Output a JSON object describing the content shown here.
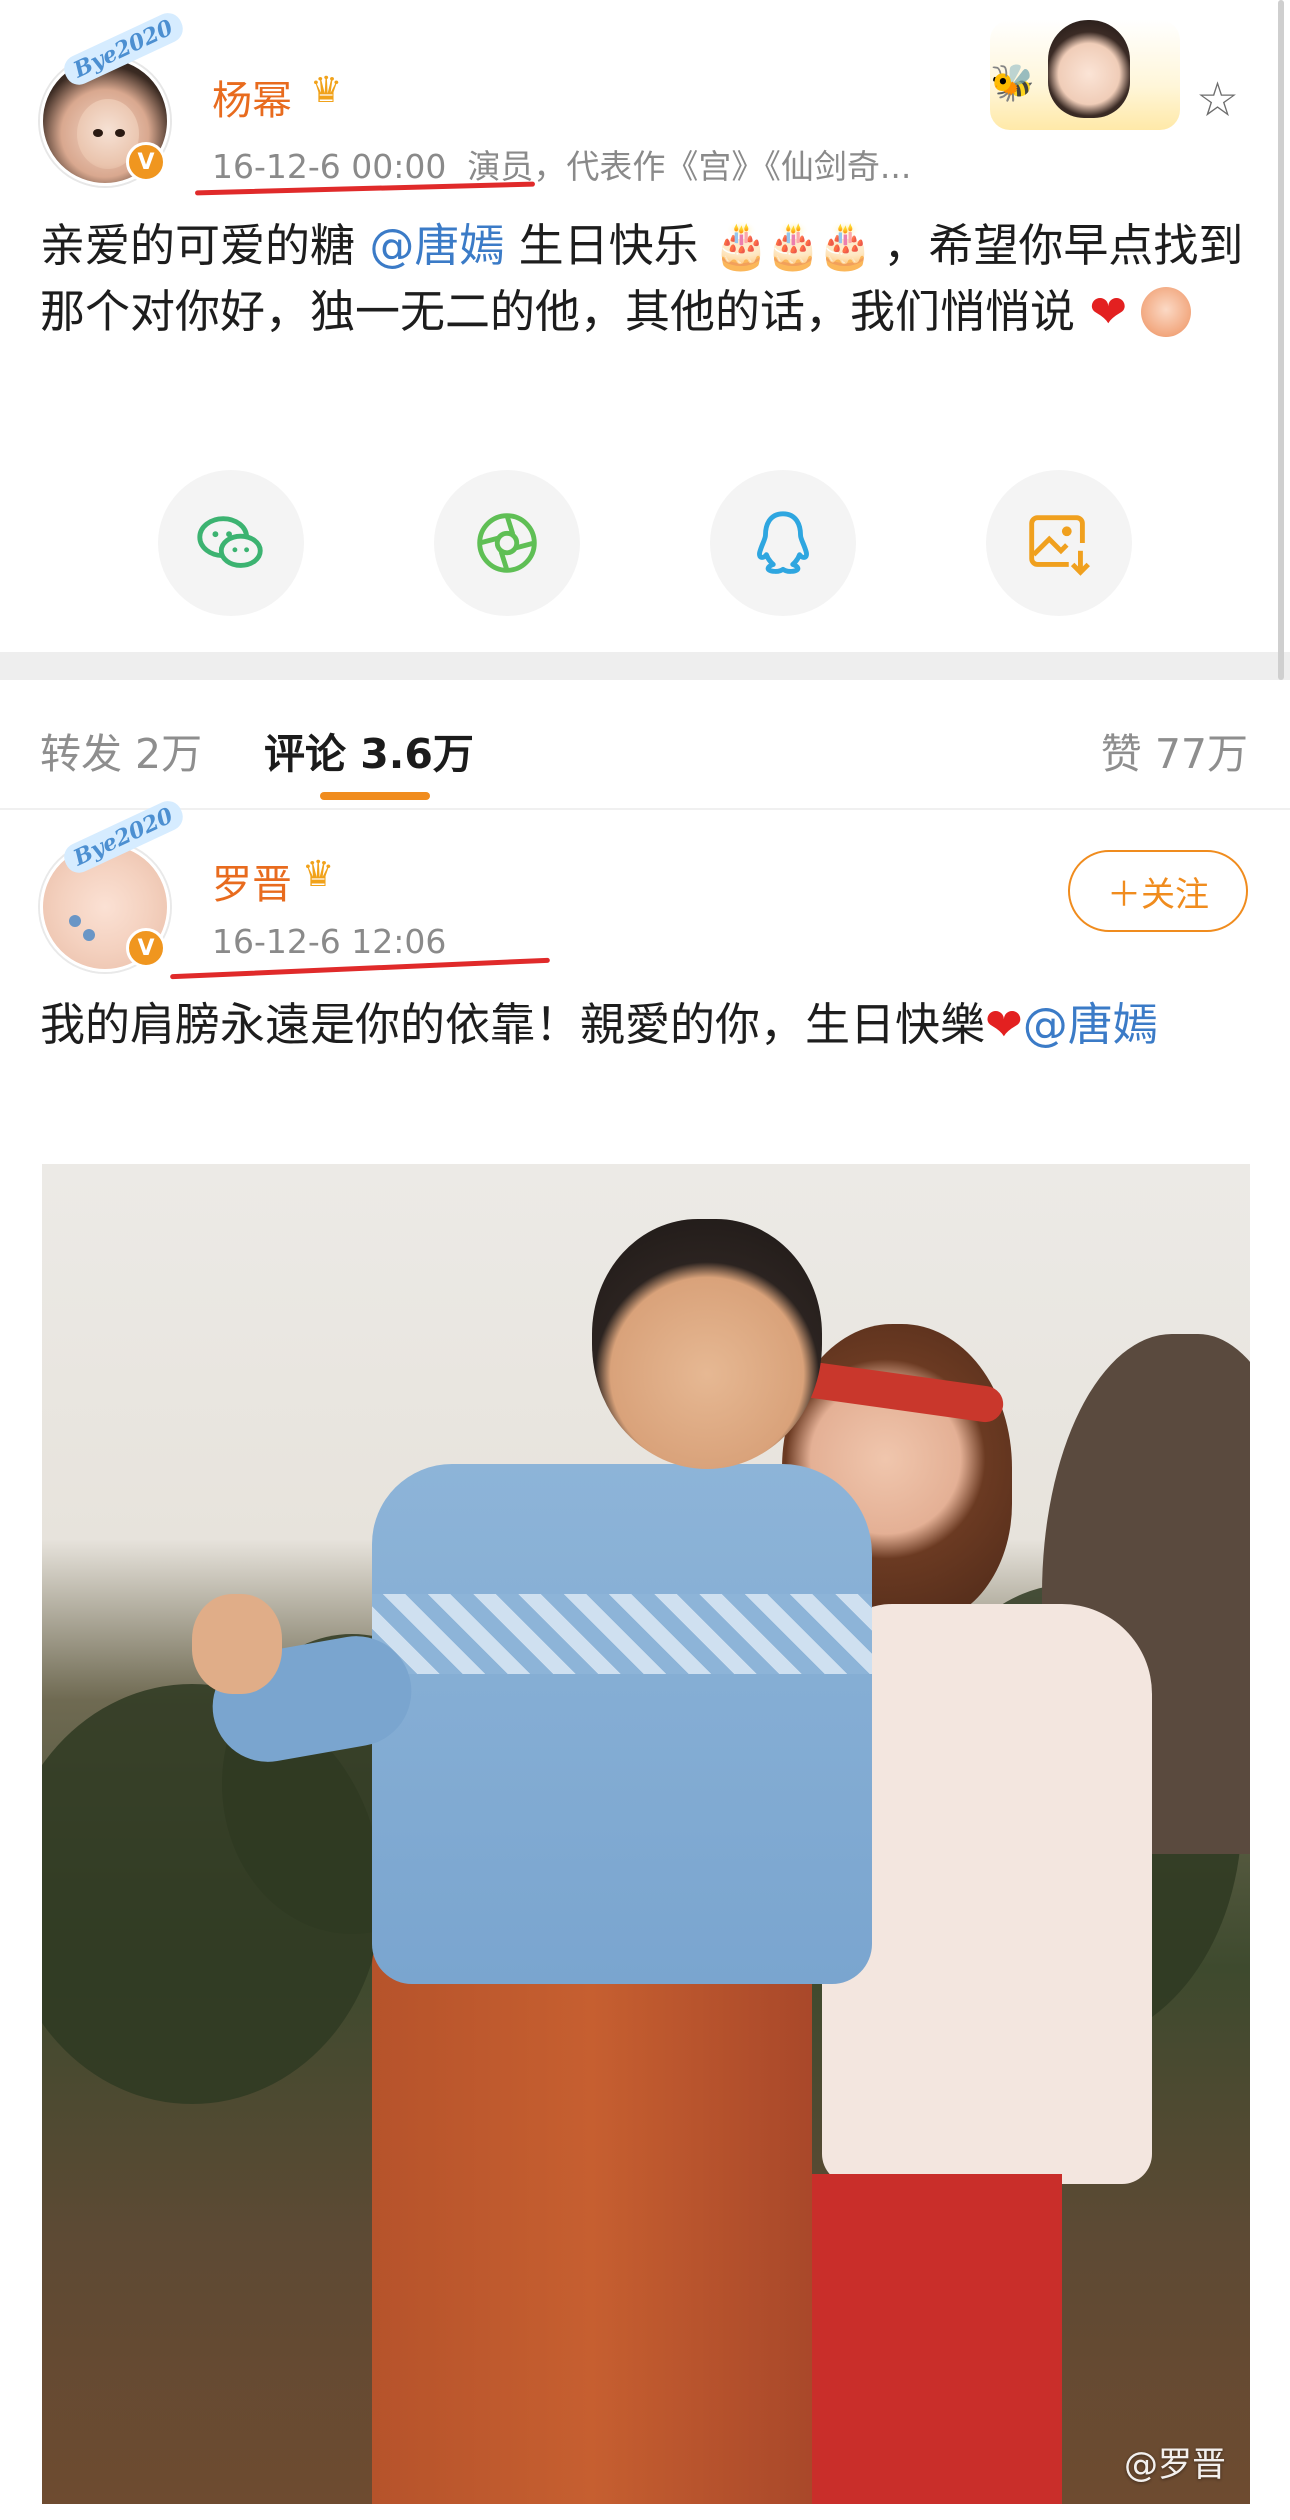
{
  "post": {
    "author": "杨幂",
    "crown_icon": "crown-icon",
    "avatar_frame_tag": "Bye2020",
    "verified_badge": "V",
    "time": "16-12-6 00:00",
    "description": "演员，代表作《宫》《仙剑奇...",
    "text_before": "亲爱的可爱的糖",
    "mention": "@唐嫣",
    "text_mid": " 生日快乐",
    "cakes": "🎂🎂🎂",
    "text_after": "，希望你早点找到那个对你好，独一无二的他，其他的话，我们悄悄说",
    "heart": "❤"
  },
  "share_buttons": [
    {
      "icon": "wechat-icon",
      "color": "#3cb371"
    },
    {
      "icon": "moments-icon",
      "color": "#5fbf55"
    },
    {
      "icon": "qq-icon",
      "color": "#2ea6e0"
    },
    {
      "icon": "save-image-icon",
      "color": "#f0a01e"
    }
  ],
  "tabs": {
    "repost": "转发 2万",
    "comment": "评论 3.6万",
    "like": "赞 77万"
  },
  "comment": {
    "author": "罗晋",
    "avatar_frame_tag": "Bye2020",
    "verified_badge": "V",
    "time": "16-12-6 12:06",
    "follow_label": "＋关注",
    "text_before": "我的肩膀永遠是你的依靠！親愛的你，生日快樂",
    "heart": "❤",
    "mention": "@唐嫣",
    "photo_watermark": "@罗晋"
  },
  "colors": {
    "accent_orange": "#f08c1e",
    "username_orange": "#e86b1e",
    "mention_blue": "#3b7bc7",
    "underline_red": "#e02a2a"
  }
}
